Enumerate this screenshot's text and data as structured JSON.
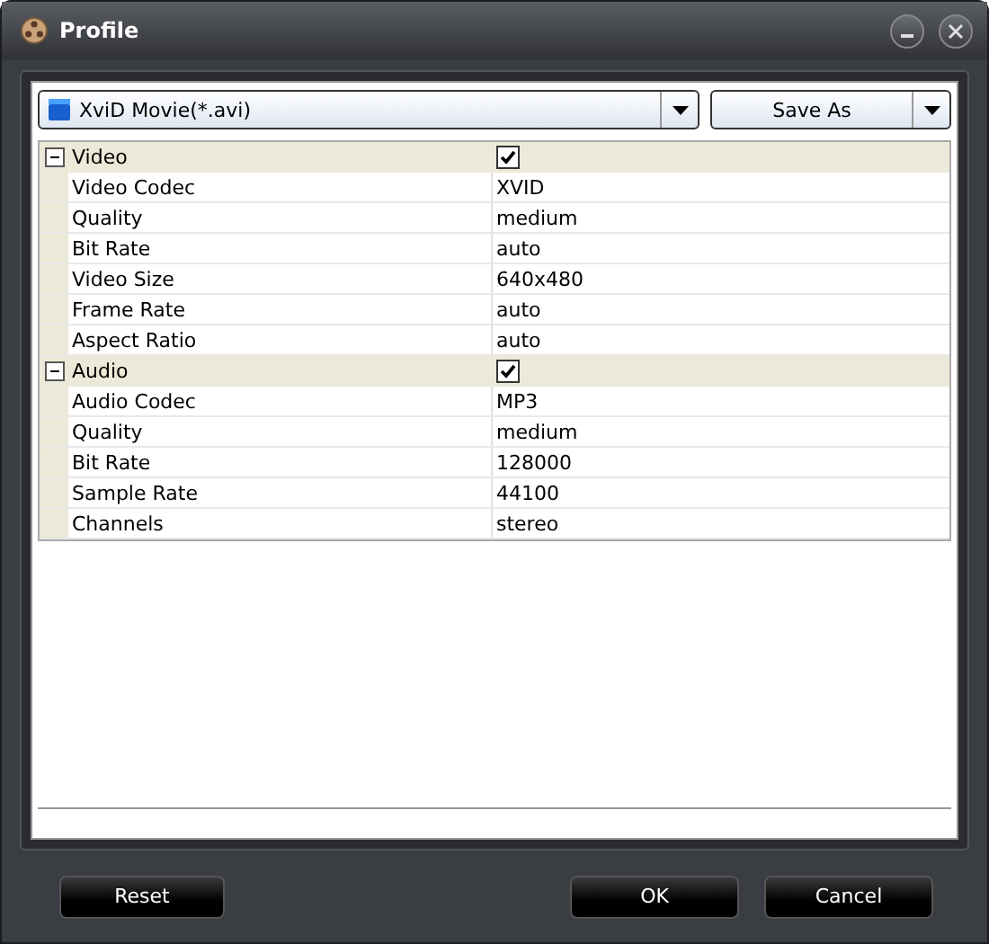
{
  "window": {
    "title": "Profile"
  },
  "profile_select": {
    "value": "XviD Movie(*.avi)"
  },
  "save_button": "Save As",
  "groups": [
    {
      "label": "Video",
      "expanded": true,
      "checked": true,
      "properties": [
        {
          "name": "Video Codec",
          "value": "XVID"
        },
        {
          "name": "Quality",
          "value": "medium"
        },
        {
          "name": "Bit Rate",
          "value": "auto"
        },
        {
          "name": "Video Size",
          "value": "640x480"
        },
        {
          "name": "Frame Rate",
          "value": "auto"
        },
        {
          "name": "Aspect Ratio",
          "value": "auto"
        }
      ]
    },
    {
      "label": "Audio",
      "expanded": true,
      "checked": true,
      "properties": [
        {
          "name": "Audio Codec",
          "value": "MP3"
        },
        {
          "name": "Quality",
          "value": "medium"
        },
        {
          "name": "Bit Rate",
          "value": "128000"
        },
        {
          "name": "Sample Rate",
          "value": "44100"
        },
        {
          "name": "Channels",
          "value": "stereo"
        }
      ]
    }
  ],
  "buttons": [
    "Reset",
    "OK",
    "Cancel"
  ]
}
